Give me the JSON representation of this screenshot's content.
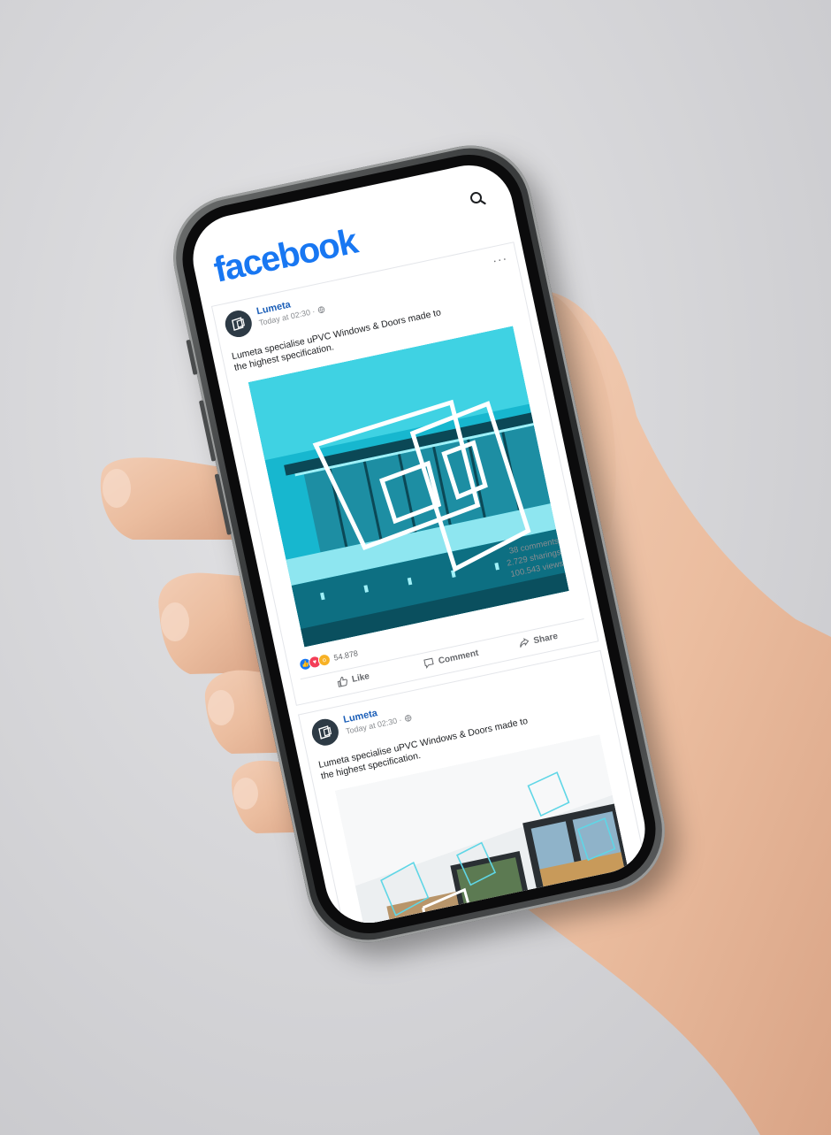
{
  "app": {
    "logo_text": "facebook",
    "brand_color": "#1877f2"
  },
  "header": {
    "search_icon": "search-icon"
  },
  "posts": [
    {
      "page_name": "Lumeta",
      "timestamp": "Today at 02:30 ·",
      "privacy_icon": "globe-icon",
      "text": "Lumeta specialise uPVC Windows & Doors made to the highest specification.",
      "image": "lumeta-logo-over-pool-house",
      "stats": {
        "comments": "38 comments",
        "sharings": "2.729 sharings",
        "views": "100.543 views"
      },
      "reactions": {
        "icons": [
          "like-icon",
          "love-icon",
          "wow-icon"
        ],
        "count": "54.878"
      },
      "actions": {
        "like": "Like",
        "comment": "Comment",
        "share": "Share"
      }
    },
    {
      "page_name": "Lumeta",
      "timestamp": "Today at 02:30 ·",
      "privacy_icon": "globe-icon",
      "text": "Lumeta specialise uPVC Windows & Doors made to the highest specification.",
      "image": "interior-with-window-outlines"
    }
  ],
  "colors": {
    "image_tint": "#1fb5cc",
    "link_blue": "#1c5fb8"
  }
}
